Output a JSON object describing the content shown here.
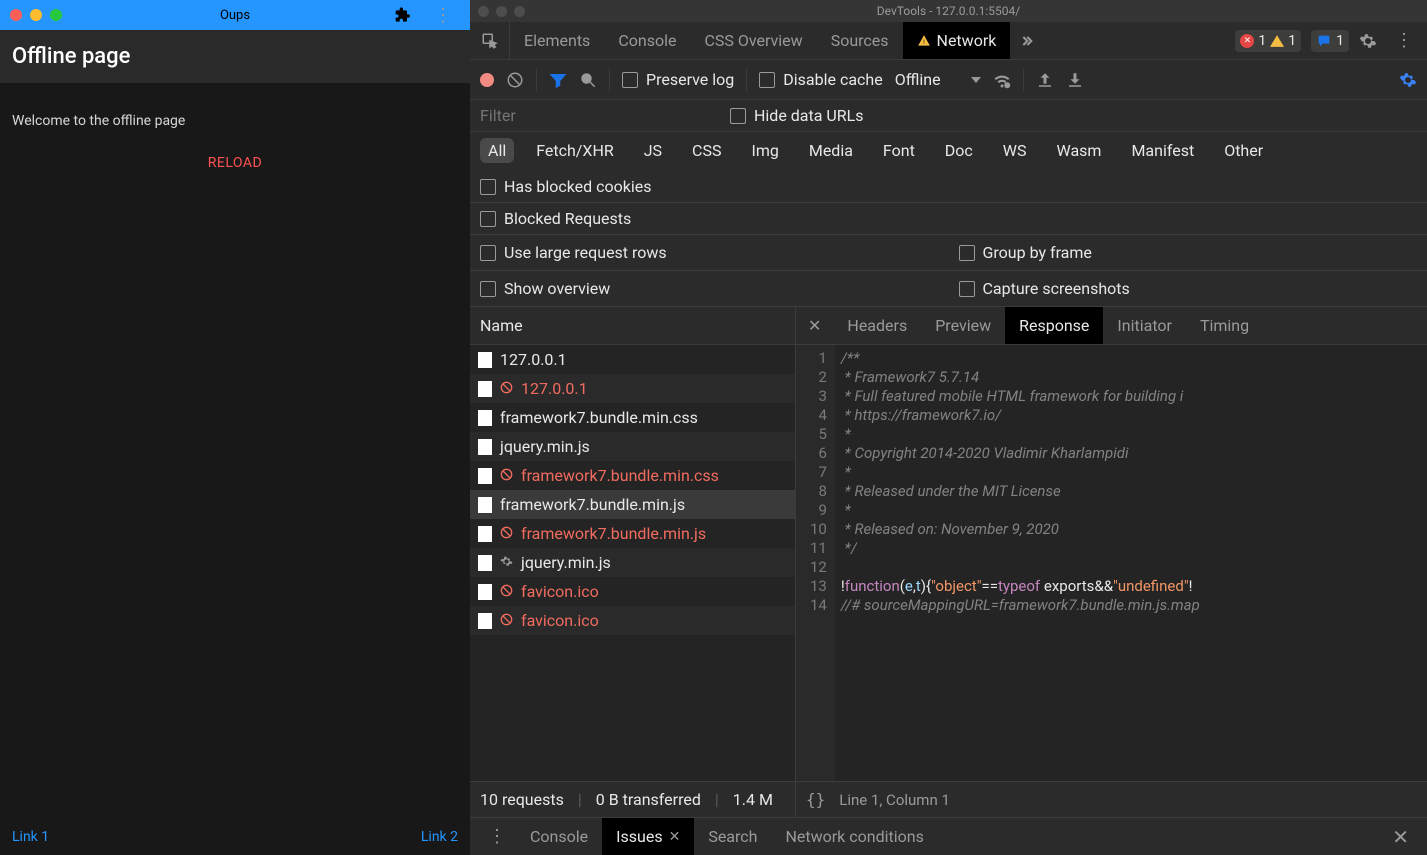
{
  "app": {
    "title": "Oups",
    "header": "Offline page",
    "welcome": "Welcome to the offline page",
    "reload": "RELOAD",
    "link1": "Link 1",
    "link2": "Link 2"
  },
  "devtools": {
    "window_title": "DevTools - 127.0.0.1:5504/",
    "tabs": {
      "elements": "Elements",
      "console": "Console",
      "css_overview": "CSS Overview",
      "sources": "Sources",
      "network": "Network"
    },
    "badges": {
      "errors": "1",
      "warnings": "1",
      "messages": "1"
    },
    "toolbar": {
      "preserve_log": "Preserve log",
      "disable_cache": "Disable cache",
      "throttle": "Offline"
    },
    "filter": {
      "placeholder": "Filter",
      "hide_data_urls": "Hide data URLs",
      "blocked_requests": "Blocked Requests",
      "has_blocked_cookies": "Has blocked cookies"
    },
    "chips": {
      "all": "All",
      "fetch": "Fetch/XHR",
      "js": "JS",
      "css": "CSS",
      "img": "Img",
      "media": "Media",
      "font": "Font",
      "doc": "Doc",
      "ws": "WS",
      "wasm": "Wasm",
      "manifest": "Manifest",
      "other": "Other"
    },
    "options": {
      "use_large_rows": "Use large request rows",
      "group_by_frame": "Group by frame",
      "show_overview": "Show overview",
      "capture_screenshots": "Capture screenshots"
    },
    "requests": {
      "header": "Name",
      "items": [
        {
          "name": "127.0.0.1",
          "err": false,
          "gear": false
        },
        {
          "name": "127.0.0.1",
          "err": true,
          "gear": false
        },
        {
          "name": "framework7.bundle.min.css",
          "err": false,
          "gear": false
        },
        {
          "name": "jquery.min.js",
          "err": false,
          "gear": false
        },
        {
          "name": "framework7.bundle.min.css",
          "err": true,
          "gear": false
        },
        {
          "name": "framework7.bundle.min.js",
          "err": false,
          "gear": false,
          "sel": true
        },
        {
          "name": "framework7.bundle.min.js",
          "err": true,
          "gear": false
        },
        {
          "name": "jquery.min.js",
          "err": false,
          "gear": true
        },
        {
          "name": "favicon.ico",
          "err": true,
          "gear": false
        },
        {
          "name": "favicon.ico",
          "err": true,
          "gear": false
        }
      ],
      "summary": {
        "count": "10 requests",
        "transferred": "0 B transferred",
        "size": "1.4 M"
      }
    },
    "response": {
      "tabs": {
        "headers": "Headers",
        "preview": "Preview",
        "response": "Response",
        "initiator": "Initiator",
        "timing": "Timing"
      },
      "lines": [
        "/**",
        " * Framework7 5.7.14",
        " * Full featured mobile HTML framework for building i",
        " * https://framework7.io/",
        " *",
        " * Copyright 2014-2020 Vladimir Kharlampidi",
        " *",
        " * Released under the MIT License",
        " *",
        " * Released on: November 9, 2020",
        " */",
        "",
        "!function(e,t){\"object\"==typeof exports&&\"undefined\"!",
        "//# sourceMappingURL=framework7.bundle.min.js.map"
      ],
      "footer": "Line 1, Column 1"
    },
    "drawer": {
      "console": "Console",
      "issues": "Issues",
      "search": "Search",
      "network_conditions": "Network conditions"
    }
  }
}
